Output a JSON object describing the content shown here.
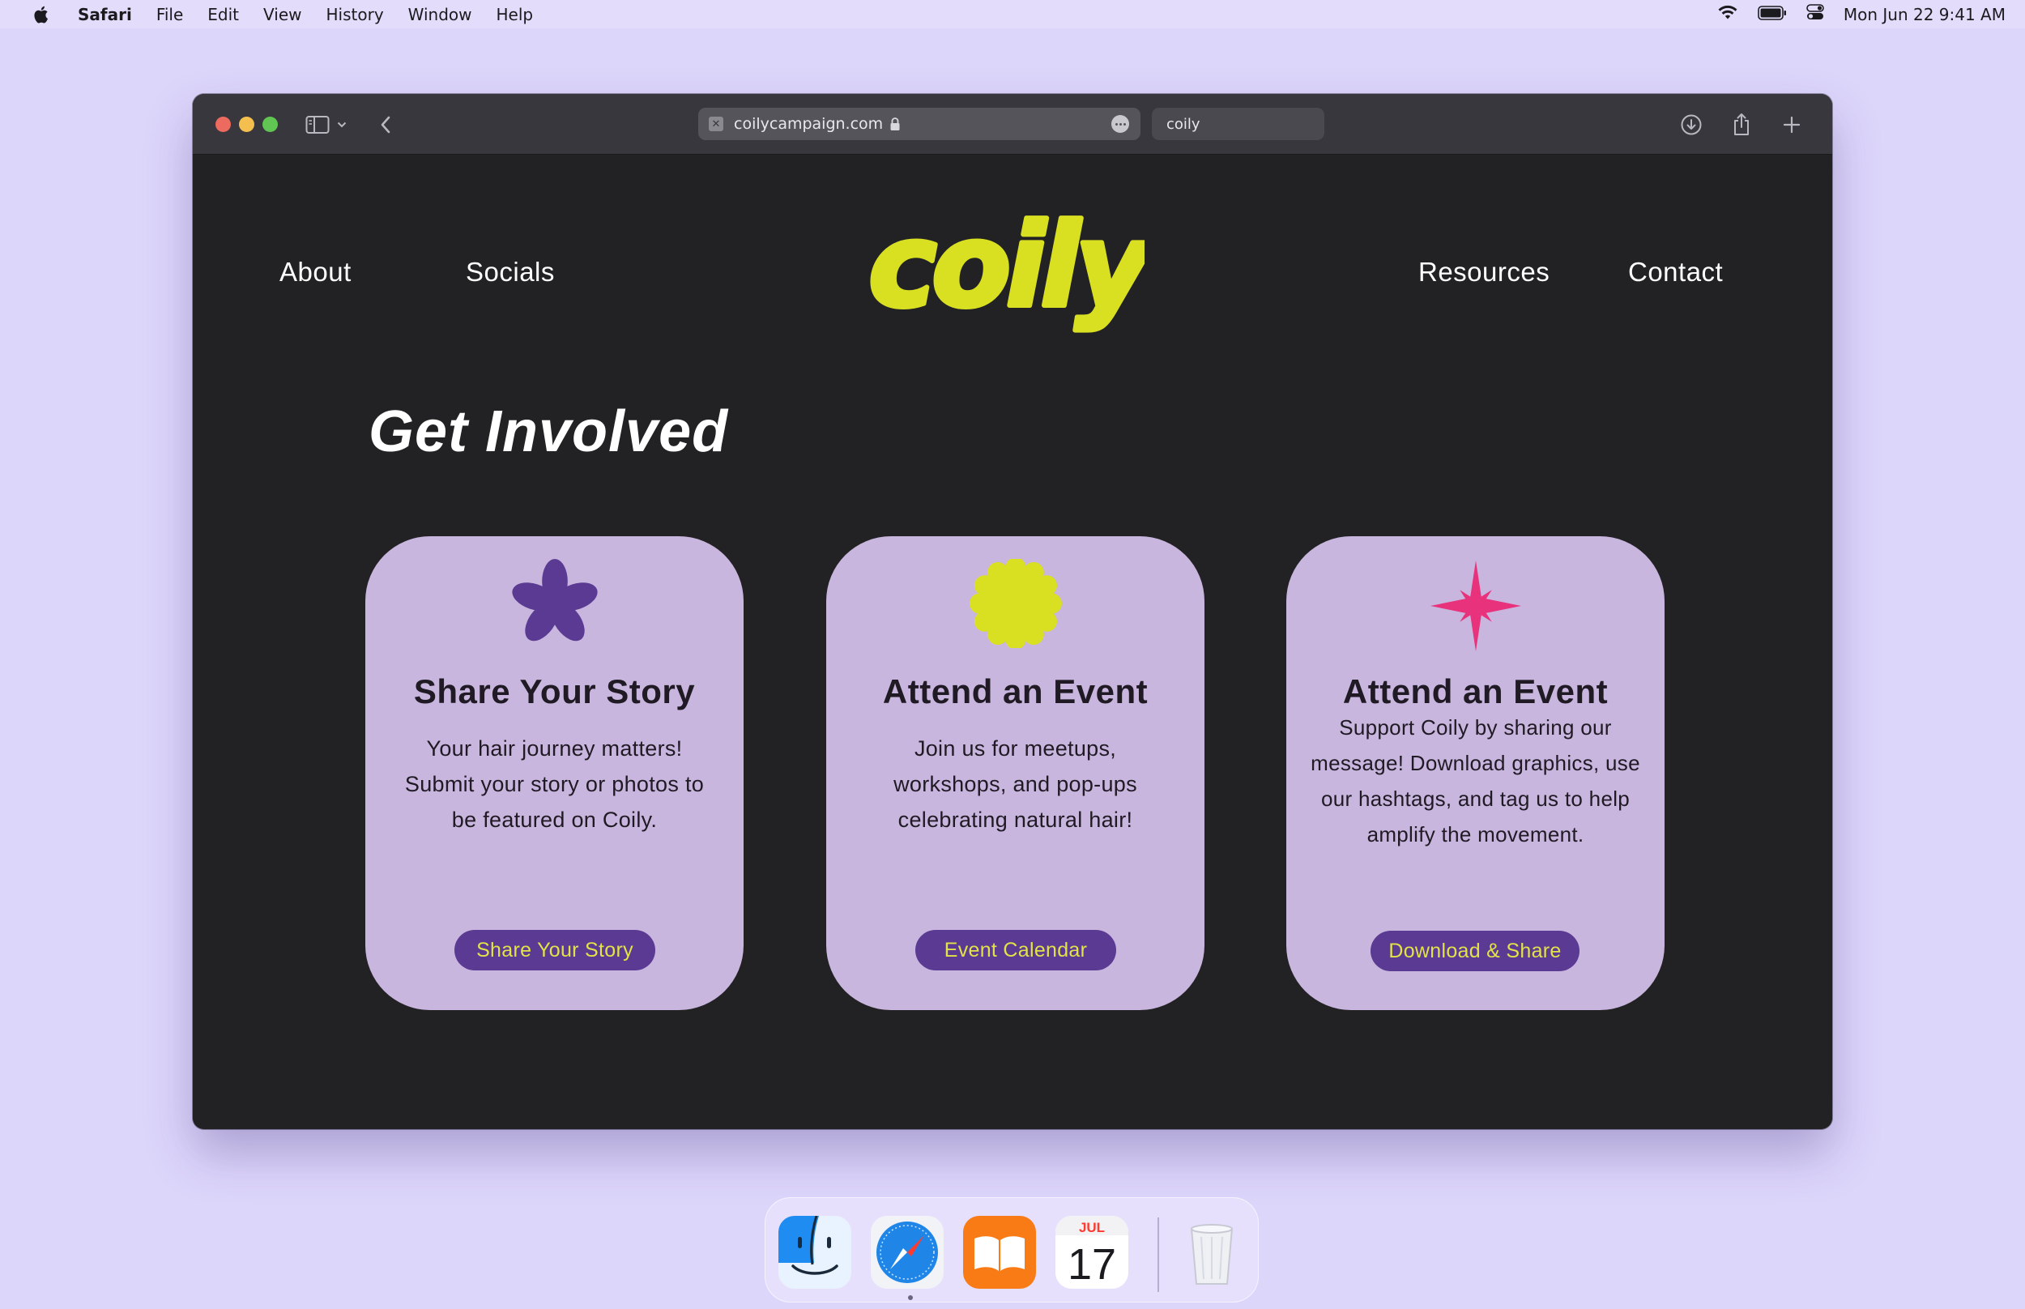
{
  "menubar": {
    "app_name": "Safari",
    "menus": [
      "File",
      "Edit",
      "View",
      "History",
      "Window",
      "Help"
    ],
    "clock": "Mon Jun 22  9:41 AM"
  },
  "browser": {
    "url": "coilycampaign.com",
    "search_text": "coily"
  },
  "site": {
    "logo_text": "coily",
    "nav_left": [
      "About",
      "Socials"
    ],
    "nav_right": [
      "Resources",
      "Contact"
    ],
    "heading": "Get Involved",
    "colors": {
      "background": "#222224",
      "card": "#c9b6de",
      "button": "#5a3a92",
      "button_text": "#e3e24a",
      "logo": "#d9e021",
      "accent_purple": "#5a3a92",
      "accent_yellow": "#d9e021",
      "accent_pink": "#e8327c"
    },
    "cards": [
      {
        "icon": "purple-flower-icon",
        "title": "Share Your Story",
        "body": "Your hair journey matters! Submit your story or photos to be featured on Coily.",
        "button": "Share Your Story"
      },
      {
        "icon": "yellow-badge-icon",
        "title": "Attend an Event",
        "body": "Join us for meetups, workshops, and pop-ups celebrating natural hair!",
        "button": "Event Calendar"
      },
      {
        "icon": "pink-sparkle-icon",
        "title": "Attend an Event",
        "body": "Support Coily by sharing our message! Download graphics, use our hashtags, and tag us to help amplify the movement.",
        "button": "Download & Share"
      }
    ]
  },
  "dock": {
    "apps": [
      "finder-icon",
      "safari-icon",
      "books-icon",
      "calendar-icon",
      "trash-icon"
    ],
    "calendar_month": "JUL",
    "calendar_day": "17"
  }
}
